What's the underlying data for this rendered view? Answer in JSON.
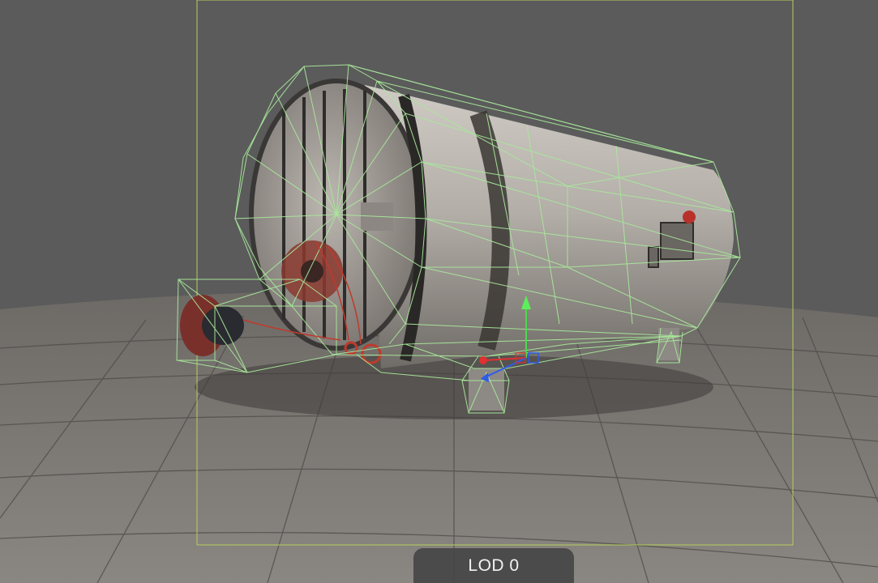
{
  "viewport": {
    "lod_label": "LOD 0",
    "accent": "#a8e89a",
    "bounds_color": "#b6cf5a"
  }
}
